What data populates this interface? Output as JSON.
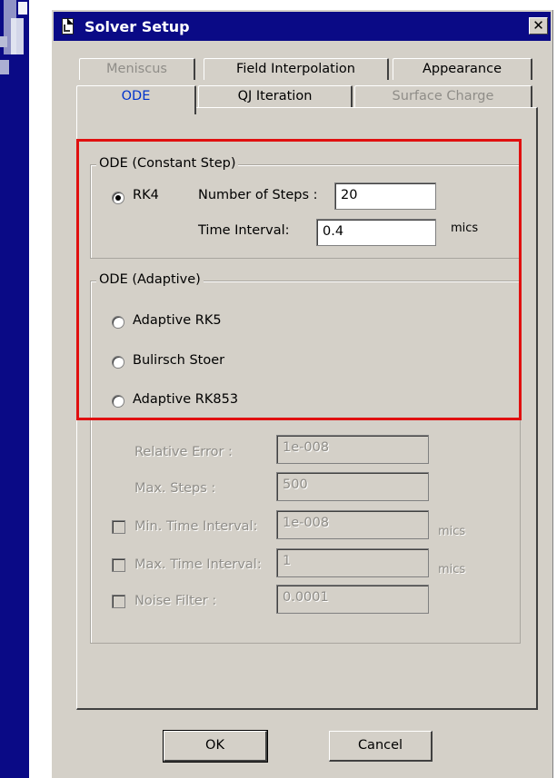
{
  "window": {
    "title": "Solver Setup",
    "close_glyph": "✕"
  },
  "tabs": {
    "row1": [
      {
        "label": "Meniscus",
        "state": "disabled"
      },
      {
        "label": "Field Interpolation",
        "state": "normal"
      },
      {
        "label": "Appearance",
        "state": "normal"
      }
    ],
    "row2": [
      {
        "label": "ODE",
        "state": "active"
      },
      {
        "label": "QJ Iteration",
        "state": "normal"
      },
      {
        "label": "Surface Charge",
        "state": "disabled"
      }
    ]
  },
  "constant_step": {
    "title": "ODE (Constant Step)",
    "rk4_label": "RK4",
    "rk4_selected": true,
    "steps_label": "Number of Steps :",
    "steps_value": "20",
    "time_interval_label": "Time Interval:",
    "time_interval_value": "0.4",
    "time_unit": "mics"
  },
  "adaptive": {
    "title": "ODE (Adaptive)",
    "options": [
      {
        "label": "Adaptive RK5",
        "selected": false
      },
      {
        "label": "Bulirsch Stoer",
        "selected": false
      },
      {
        "label": "Adaptive RK853",
        "selected": false
      }
    ],
    "relative_error_label": "Relative Error :",
    "relative_error_value": "1e-008",
    "max_steps_label": "Max. Steps :",
    "max_steps_value": "500",
    "min_interval_label": "Min. Time Interval:",
    "min_interval_value": "1e-008",
    "max_interval_label": "Max. Time Interval:",
    "max_interval_value": "1",
    "noise_filter_label": "Noise Filter :",
    "noise_filter_value": "0.0001",
    "unit": "mics"
  },
  "buttons": {
    "ok": "OK",
    "cancel": "Cancel"
  },
  "colors": {
    "titlebar": "#0a0a86",
    "dialog": "#d4d0c8",
    "highlight": "#e01010",
    "active_tab": "#0033cc"
  }
}
